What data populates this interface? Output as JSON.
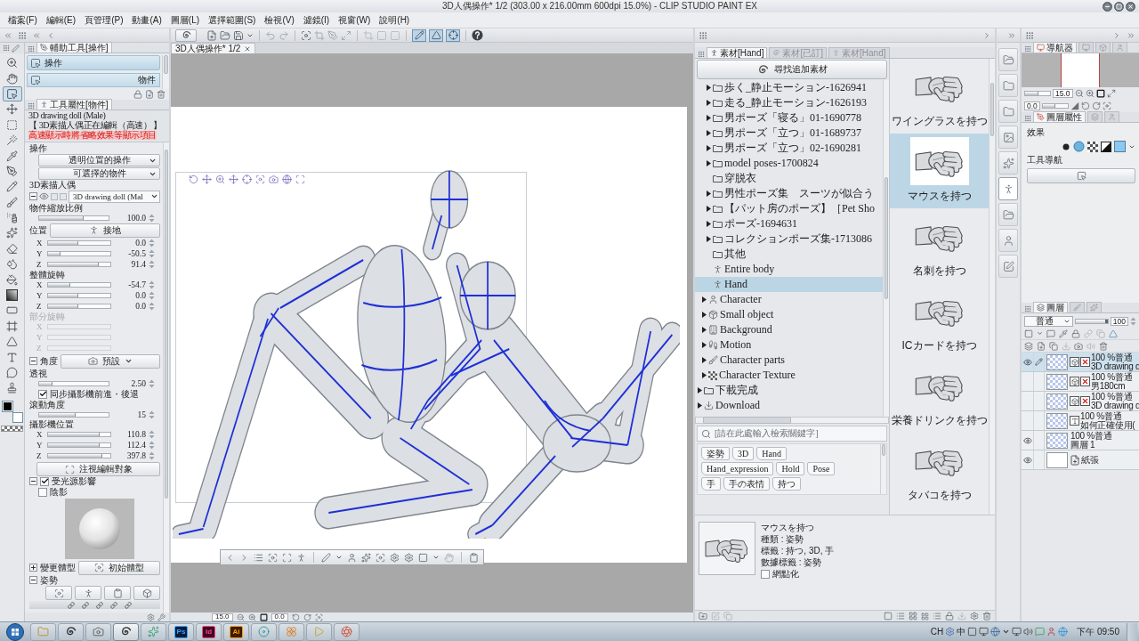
{
  "window": {
    "title": "3D人偶操作* 1/2 (303.00 x 216.00mm 600dpi 15.0%) - CLIP STUDIO PAINT EX"
  },
  "menu": [
    "檔案(F)",
    "編輯(E)",
    "頁管理(P)",
    "動畫(A)",
    "圖層(L)",
    "選擇範圍(S)",
    "檢視(V)",
    "濾鏡(I)",
    "視窗(W)",
    "說明(H)"
  ],
  "canvas_toolbar": {
    "toggles": [
      {
        "selected": true
      },
      {
        "selected": true
      },
      {
        "selected": true
      }
    ]
  },
  "document_tab": {
    "label": "3D人偶操作* 1/2"
  },
  "tools": [
    {
      "selected": false
    },
    {
      "selected": false
    },
    {
      "selected": true
    },
    {
      "selected": false
    },
    {
      "selected": false
    },
    {
      "selected": false
    },
    {
      "selected": false
    },
    {
      "selected": false
    },
    {
      "selected": false
    },
    {
      "selected": false
    },
    {
      "selected": false
    },
    {
      "selected": false
    },
    {
      "selected": false
    },
    {
      "selected": false
    },
    {
      "selected": false
    },
    {
      "selected": false
    },
    {
      "selected": false
    },
    {
      "selected": false
    },
    {
      "selected": false
    },
    {
      "selected": false
    },
    {
      "selected": false
    },
    {
      "selected": false
    }
  ],
  "color_swatches": [
    {
      "color": "#000000"
    },
    {
      "color": "#ffffff"
    }
  ],
  "subtool": {
    "tab": "輔助工具[操作]",
    "group": "操作",
    "items": [
      {
        "label": "物件",
        "selected": true
      }
    ]
  },
  "tool_property": {
    "tab": "工具屬性[物件]",
    "object": "3D drawing doll (Male)",
    "status": "【 3D素描人偶正在編輯（高速） 】",
    "warning": "高速顯示時將省略效果等顯示項目",
    "sections": [
      {
        "label": "操作",
        "disabled": false,
        "rows": [
          {
            "kind": "dropdown",
            "value": "透明位置的操作"
          },
          {
            "kind": "dropdown",
            "value": "可選擇的物件"
          }
        ]
      },
      {
        "label": "3D素描人偶",
        "disabled": false,
        "rows": [
          {
            "kind": "doll",
            "value": "3D drawing doll (Mal",
            "expanded": true,
            "visible": true
          }
        ]
      },
      {
        "label": "物件縮放比例",
        "disabled": false,
        "rows": [
          {
            "kind": "slider",
            "level": 0.64,
            "value": "100.0"
          }
        ]
      },
      {
        "label": "位置",
        "disabled": false,
        "button": "接地",
        "rows": [
          {
            "kind": "axis",
            "axis": "X",
            "level": 0.49,
            "value": "0.0"
          },
          {
            "kind": "axis",
            "axis": "Y",
            "level": 0.2,
            "value": "-50.5"
          },
          {
            "kind": "axis",
            "axis": "Z",
            "level": 0.82,
            "value": "91.4"
          }
        ]
      },
      {
        "label": "整體旋轉",
        "disabled": false,
        "rows": [
          {
            "kind": "axis",
            "axis": "X",
            "level": 0.35,
            "value": "-54.7"
          },
          {
            "kind": "axis",
            "axis": "Y",
            "level": 0.49,
            "value": "0.0"
          },
          {
            "kind": "axis",
            "axis": "Z",
            "level": 0.49,
            "value": "0.0"
          }
        ]
      },
      {
        "label": "部分旋轉",
        "disabled": true,
        "rows": [
          {
            "kind": "axis",
            "axis": "X"
          },
          {
            "kind": "axis",
            "axis": "Y"
          },
          {
            "kind": "axis",
            "axis": "Z"
          }
        ]
      },
      {
        "label": "角度",
        "disabled": false,
        "expanded": true,
        "dropdown": "預設"
      },
      {
        "label": "透視",
        "disabled": false,
        "rows": [
          {
            "kind": "slider",
            "level": 0.19,
            "value": "2.50"
          },
          {
            "kind": "checkbox",
            "label": "同步攝影機前進・後退",
            "checked": true
          }
        ]
      },
      {
        "label": "滾動角度",
        "disabled": false,
        "rows": [
          {
            "kind": "slider",
            "level": 0.52,
            "value": "15"
          }
        ]
      },
      {
        "label": "攝影機位置",
        "disabled": false,
        "rows": [
          {
            "kind": "axis",
            "axis": "X",
            "level": 0.83,
            "value": "110.8"
          },
          {
            "kind": "axis",
            "axis": "Y",
            "level": 0.83,
            "value": "112.4"
          },
          {
            "kind": "axis",
            "axis": "Z",
            "level": 0.87,
            "value": "397.8"
          },
          {
            "kind": "button",
            "label": "注視編輯對象"
          }
        ]
      },
      {
        "label": "受光源影響",
        "disabled": false,
        "expanded": true,
        "checked": true,
        "rows": [
          {
            "kind": "checkbox",
            "label": "陰影",
            "checked": false
          },
          {
            "kind": "preview"
          }
        ]
      },
      {
        "label": "變更體型",
        "disabled": false,
        "expanded": false,
        "button": "初始體型"
      },
      {
        "label": "姿勢",
        "disabled": false,
        "expanded": true,
        "rows": [
          {
            "kind": "pose_tools"
          },
          {
            "kind": "link_row"
          }
        ]
      }
    ]
  },
  "canvas_status": {
    "zoom": "15.0",
    "angle": "0.0"
  },
  "materials": {
    "tabs": [
      {
        "label": "素材[Hand]",
        "selected": true
      },
      {
        "label": "素材[已訂]",
        "selected": false
      },
      {
        "label": "素材[Hand]",
        "selected": false
      }
    ],
    "find_button": "尋找追加素材",
    "tree": [
      {
        "children": [
          {
            "children": [
              {
                "label": "歩く_静止モーション-1626941",
                "kind": "folder",
                "expandable": true,
                "selected": false
              },
              {
                "label": "走る_静止モーション-1626193",
                "kind": "folder",
                "expandable": true,
                "selected": false
              },
              {
                "label": "男ポーズ「寝る」01-1690778",
                "kind": "folder",
                "expandable": true,
                "selected": false
              },
              {
                "label": "男ポーズ「立つ」01-1689737",
                "kind": "folder",
                "expandable": true,
                "selected": false
              },
              {
                "label": "男ポーズ「立つ」02-1690281",
                "kind": "folder",
                "expandable": true,
                "selected": false
              },
              {
                "label": "model poses-1700824",
                "kind": "folder",
                "expandable": true,
                "selected": false
              },
              {
                "label": "穿脱衣",
                "kind": "folder",
                "expandable": false,
                "selected": false
              },
              {
                "label": "男性ポーズ集　スーツが似合う",
                "kind": "folder",
                "expandable": true,
                "selected": false
              },
              {
                "label": "【パット房のポーズ】［Pet Sho",
                "kind": "folder",
                "expandable": true,
                "selected": false
              },
              {
                "label": "ポーズ-1694631",
                "kind": "folder",
                "expandable": true,
                "selected": false
              },
              {
                "label": "コレクションポーズ集-1713086",
                "kind": "folder",
                "expandable": true,
                "selected": false
              },
              {
                "label": "其他",
                "kind": "folder",
                "expandable": false,
                "selected": false
              },
              {
                "label": "Entire body",
                "kind": "pose",
                "expandable": false,
                "selected": false
              },
              {
                "label": "Hand",
                "kind": "pose",
                "expandable": false,
                "selected": true
              }
            ]
          },
          {
            "label": "Character",
            "kind": "character",
            "expandable": true,
            "selected": false
          },
          {
            "label": "Small object",
            "kind": "object",
            "expandable": true,
            "selected": false
          },
          {
            "label": "Background",
            "kind": "background",
            "expandable": true,
            "selected": false
          },
          {
            "label": "Motion",
            "kind": "motion",
            "expandable": true,
            "selected": false
          },
          {
            "label": "Character parts",
            "kind": "parts",
            "expandable": true,
            "selected": false
          },
          {
            "label": "Character Texture",
            "kind": "texture",
            "expandable": true,
            "selected": false
          }
        ]
      },
      {
        "label": "下載完成",
        "kind": "folder",
        "expandable": true,
        "selected": false
      },
      {
        "label": "Download",
        "kind": "download",
        "expandable": true,
        "selected": false
      }
    ],
    "thumbnails": [
      {
        "caption": "ワイングラスを持つ",
        "selected": false
      },
      {
        "caption": "マウスを持つ",
        "selected": true
      },
      {
        "caption": "名刺を持つ",
        "selected": false
      },
      {
        "caption": "ICカードを持つ",
        "selected": false
      },
      {
        "caption": "栄養ドリンクを持つ",
        "selected": false
      },
      {
        "caption": "タバコを持つ",
        "selected": false
      }
    ],
    "search": {
      "placeholder": "[請在此處輸入檢索關鍵字]"
    },
    "tags": [
      [
        "姿勢",
        "3D",
        "Hand"
      ],
      [
        "Hand_expression",
        "Hold",
        "Pose"
      ],
      [
        "手",
        "手の表情",
        "持つ"
      ]
    ],
    "detail": {
      "title": "マウスを持つ",
      "lines": [
        "種類 : 姿勢",
        "標籤 : 持つ, 3D, 手",
        "數據標籤 : 姿勢"
      ],
      "option": {
        "label": "網點化",
        "checked": false
      }
    }
  },
  "side_icons": [
    {
      "selected": false
    },
    {
      "selected": false
    },
    {
      "selected": false
    },
    {
      "selected": false
    },
    {
      "selected": false
    },
    {
      "selected": true
    },
    {
      "selected": false
    },
    {
      "selected": false
    },
    {
      "selected": false
    }
  ],
  "navigator": {
    "tabs": [
      {
        "label": "導航器",
        "selected": true
      },
      {
        "selected": false
      },
      {
        "selected": false
      },
      {
        "selected": false
      }
    ],
    "zoom": {
      "value": "15.0",
      "level": 0.55
    },
    "angle": {
      "value": "0.0",
      "level": 0.5
    }
  },
  "layer_property": {
    "tabs": [
      {
        "label": "圖層屬性",
        "selected": true
      },
      {
        "selected": false
      },
      {
        "selected": false
      }
    ],
    "effect": "效果",
    "tool_nav": "工具導航"
  },
  "layers": {
    "tabs": [
      {
        "label": "圖層",
        "selected": true
      },
      {
        "selected": false
      },
      {
        "selected": false
      }
    ],
    "blend_mode": "普通",
    "opacity": {
      "value": "100",
      "level": 1
    },
    "rows": [
      {
        "kind": "model",
        "mode": "100 %普通",
        "name": "3D drawing d",
        "visible": true,
        "editing": true,
        "selected": true
      },
      {
        "kind": "model",
        "mode": "100 %普通",
        "name": "男180cm",
        "visible": false,
        "editing": false,
        "selected": false
      },
      {
        "kind": "model",
        "mode": "100 %普通",
        "name": "3D drawing d",
        "visible": false,
        "editing": false,
        "selected": false
      },
      {
        "kind": "text",
        "mode": "100 %普通",
        "name": "如何正確使用(",
        "visible": false,
        "editing": false,
        "selected": false
      },
      {
        "kind": "raster",
        "mode": "100 %普通",
        "name": "圖層 1",
        "visible": true,
        "editing": false,
        "selected": false
      },
      {
        "kind": "paper",
        "name": "紙張",
        "visible": true,
        "editing": false,
        "selected": false
      }
    ]
  },
  "taskbar": {
    "apps": [
      {
        "selected": false
      },
      {
        "selected": false
      },
      {
        "selected": false
      },
      {
        "selected": true
      },
      {
        "selected": false
      },
      {
        "label": "Ps",
        "selected": false
      },
      {
        "label": "Id",
        "selected": false
      },
      {
        "label": "Ai",
        "selected": false
      },
      {
        "selected": false
      },
      {
        "selected": false
      },
      {
        "selected": false
      },
      {
        "selected": false
      }
    ],
    "tray": {
      "language": "CH",
      "ime": "中",
      "time": "下午 09:50"
    }
  }
}
